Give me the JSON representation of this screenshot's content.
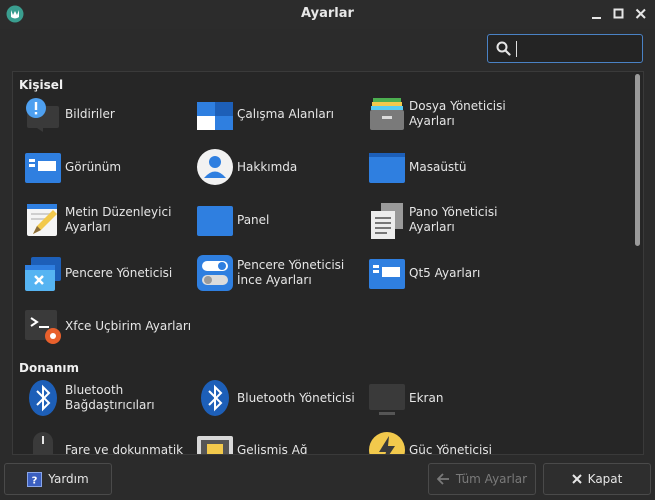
{
  "window": {
    "title": "Ayarlar"
  },
  "search": {
    "placeholder": "",
    "value": ""
  },
  "sections": [
    {
      "label": "Kişisel",
      "items": [
        {
          "label": "Bildiriler",
          "icon": "notifications-icon"
        },
        {
          "label": "Çalışma Alanları",
          "icon": "workspaces-icon"
        },
        {
          "label": "Dosya Yöneticisi\nAyarları",
          "icon": "file-manager-icon"
        },
        {
          "label": "Görünüm",
          "icon": "appearance-icon"
        },
        {
          "label": "Hakkımda",
          "icon": "about-me-icon"
        },
        {
          "label": "Masaüstü",
          "icon": "desktop-icon"
        },
        {
          "label": "Metin Düzenleyici\nAyarları",
          "icon": "text-editor-icon"
        },
        {
          "label": "Panel",
          "icon": "panel-icon"
        },
        {
          "label": "Pano Yöneticisi\nAyarları",
          "icon": "clipboard-manager-icon"
        },
        {
          "label": "Pencere Yöneticisi",
          "icon": "window-manager-icon"
        },
        {
          "label": "Pencere Yöneticisi\nİnce Ayarları",
          "icon": "window-tweaks-icon"
        },
        {
          "label": "Qt5 Ayarları",
          "icon": "qt5-settings-icon"
        },
        {
          "label": "Xfce Uçbirim Ayarları",
          "icon": "terminal-settings-icon"
        }
      ]
    },
    {
      "label": "Donanım",
      "items": [
        {
          "label": "Bluetooth\nBağdaştırıcıları",
          "icon": "bluetooth-icon"
        },
        {
          "label": "Bluetooth Yöneticisi",
          "icon": "bluetooth-manager-icon"
        },
        {
          "label": "Ekran",
          "icon": "display-icon"
        },
        {
          "label": "Fare ve dokunmatik",
          "icon": "mouse-icon"
        },
        {
          "label": "Gelişmiş Ağ",
          "icon": "network-icon"
        },
        {
          "label": "Güç Yöneticisi",
          "icon": "power-manager-icon"
        }
      ]
    }
  ],
  "footer": {
    "help_label": "Yardım",
    "all_settings_label": "Tüm Ayarlar",
    "close_label": "Kapat"
  },
  "colors": {
    "accent": "#4a82c5",
    "icon_blue": "#2f7fe0",
    "background": "#2b2b2b"
  }
}
